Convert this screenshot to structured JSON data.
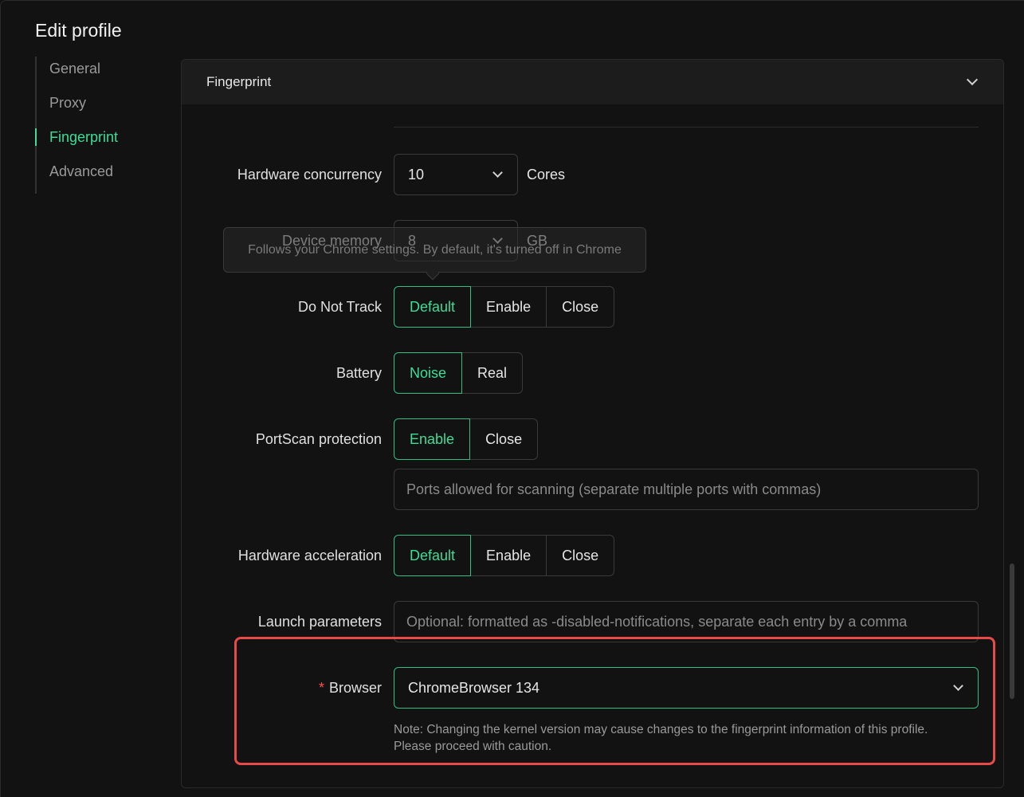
{
  "page": {
    "title": "Edit profile"
  },
  "nav": {
    "items": [
      {
        "label": "General",
        "active": false
      },
      {
        "label": "Proxy",
        "active": false
      },
      {
        "label": "Fingerprint",
        "active": true
      },
      {
        "label": "Advanced",
        "active": false
      }
    ]
  },
  "section": {
    "title": "Fingerprint"
  },
  "fields": {
    "hardware_concurrency": {
      "label": "Hardware concurrency",
      "value": "10",
      "unit": "Cores"
    },
    "device_memory": {
      "label": "Device memory",
      "value": "8",
      "unit": "GB"
    },
    "do_not_track": {
      "label": "Do Not Track",
      "options": [
        "Default",
        "Enable",
        "Close"
      ],
      "selected": "Default",
      "tooltip": "Follows your Chrome settings. By default, it's turned off in Chrome"
    },
    "battery": {
      "label": "Battery",
      "options": [
        "Noise",
        "Real"
      ],
      "selected": "Noise"
    },
    "portscan": {
      "label": "PortScan protection",
      "options": [
        "Enable",
        "Close"
      ],
      "selected": "Enable",
      "ports_placeholder": "Ports allowed for scanning (separate multiple ports with commas)"
    },
    "hardware_acceleration": {
      "label": "Hardware acceleration",
      "options": [
        "Default",
        "Enable",
        "Close"
      ],
      "selected": "Default"
    },
    "launch_parameters": {
      "label": "Launch parameters",
      "placeholder": "Optional: formatted as -disabled-notifications, separate each entry by a comma"
    },
    "browser": {
      "label": "Browser",
      "required_mark": "*",
      "value": "ChromeBrowser 134",
      "note_line1": "Note: Changing the kernel version may cause changes to the fingerprint information of this profile.",
      "note_line2": "Please proceed with caution."
    }
  },
  "colors": {
    "accent": "#3ddc97",
    "highlight": "#e84a4a",
    "background": "#121212"
  }
}
